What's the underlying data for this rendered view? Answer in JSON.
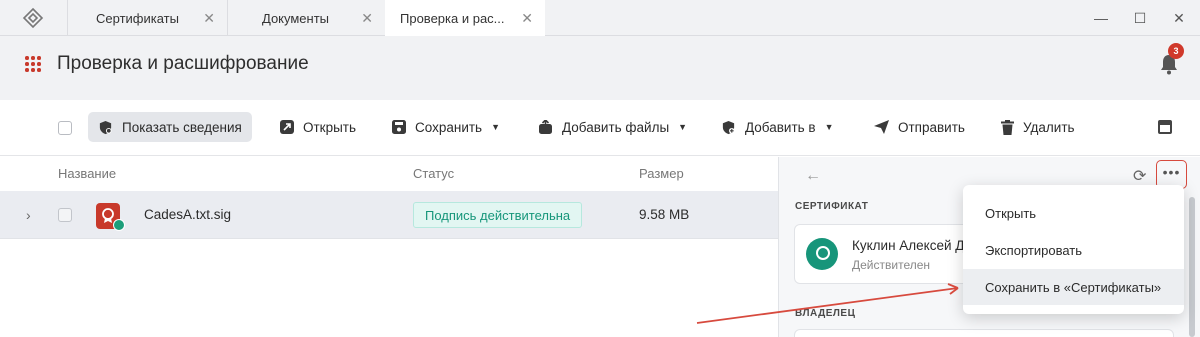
{
  "tabs": [
    {
      "label": "Сертификаты"
    },
    {
      "label": "Документы"
    },
    {
      "label": "Проверка и рас..."
    }
  ],
  "window_controls": {
    "minimize": "—",
    "maximize": "☐",
    "close": "✕"
  },
  "header": {
    "title": "Проверка и расшифрование",
    "notifications_count": "3"
  },
  "toolbar": {
    "show_info": "Показать сведения",
    "open": "Открыть",
    "save": "Сохранить",
    "add_files": "Добавить файлы",
    "add_to": "Добавить в",
    "send": "Отправить",
    "delete": "Удалить"
  },
  "table": {
    "columns": [
      "Название",
      "Статус",
      "Размер"
    ],
    "rows": [
      {
        "name": "CadesA.txt.sig",
        "status": "Подпись действительна",
        "size": "9.58 MB"
      }
    ]
  },
  "panel": {
    "certificate_label": "СЕРТИФИКАТ",
    "cert_name": "Куклин Алексей Д",
    "cert_status": "Действителен",
    "owner_label": "ВЛАДЕЛЕЦ"
  },
  "menu": {
    "items": [
      {
        "label": "Открыть"
      },
      {
        "label": "Экспортировать"
      },
      {
        "label": "Сохранить в «Сертификаты»"
      }
    ]
  },
  "colors": {
    "accent_red": "#c8392b",
    "status_green": "#16967a",
    "annotation_red": "#d74a3e"
  }
}
